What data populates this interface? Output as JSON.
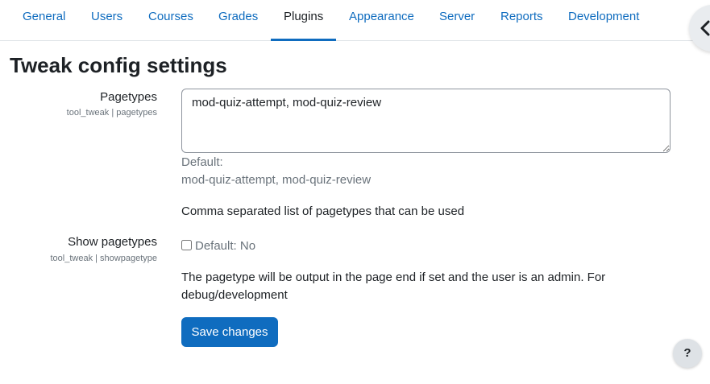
{
  "nav": {
    "tabs": [
      {
        "label": "General"
      },
      {
        "label": "Users"
      },
      {
        "label": "Courses"
      },
      {
        "label": "Grades"
      },
      {
        "label": "Plugins",
        "active": true
      },
      {
        "label": "Appearance"
      },
      {
        "label": "Server"
      },
      {
        "label": "Reports"
      },
      {
        "label": "Development"
      }
    ],
    "drawer_icon": "chevron-left-icon"
  },
  "page": {
    "title": "Tweak config settings"
  },
  "settings": {
    "pagetypes": {
      "label": "Pagetypes",
      "name": "tool_tweak | pagetypes",
      "value": "mod-quiz-attempt, mod-quiz-review",
      "default_label": "Default:",
      "default_value": "mod-quiz-attempt, mod-quiz-review",
      "description": "Comma separated list of pagetypes that can be used"
    },
    "showpagetypes": {
      "label": "Show pagetypes",
      "name": "tool_tweak | showpagetype",
      "checked": false,
      "default_text": "Default: No",
      "description": "The pagetype will be output in the page end if set and the user is an admin. For debug/development"
    }
  },
  "actions": {
    "save_label": "Save changes"
  },
  "help": {
    "label": "?"
  },
  "colors": {
    "accent": "#0f6cbf",
    "text": "#1d2125",
    "muted": "#6a737b"
  }
}
